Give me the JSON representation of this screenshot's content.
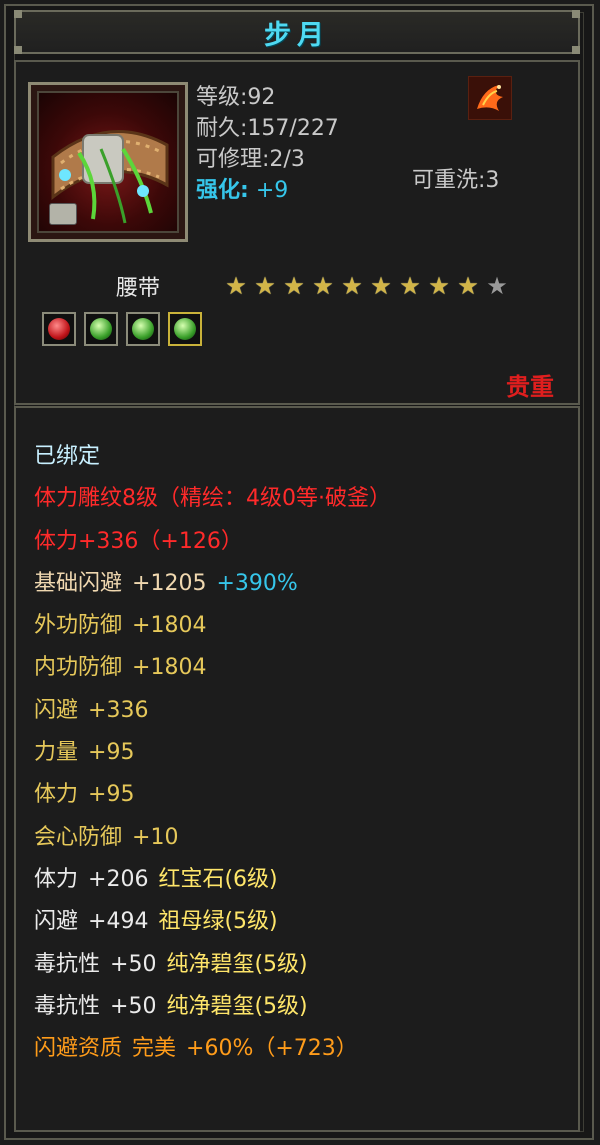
{
  "title": "步月",
  "item": {
    "level": "等级:92",
    "durability": "耐久:157/227",
    "repair": "可修理:2/3",
    "rewash": "可重洗:3",
    "enhance_label": "强化:",
    "enhance_value": "+9",
    "type": "腰带",
    "stars_filled": 9,
    "stars_total": 10,
    "rarity": "贵重",
    "sockets": [
      "red-gem",
      "green-gem",
      "green-gem",
      "green-gem"
    ]
  },
  "properties": [
    {
      "parts": [
        {
          "text": "已绑定",
          "color": "#c8f0ff"
        }
      ]
    },
    {
      "parts": [
        {
          "text": "体力雕纹8级（精绘：4级0等·破釜）",
          "color": "#ff2a2a"
        }
      ]
    },
    {
      "parts": [
        {
          "text": "体力+336（+126）",
          "color": "#ff2a2a"
        }
      ]
    },
    {
      "parts": [
        {
          "text": "基础闪避",
          "color": "#f0d8b0"
        },
        {
          "text": "+1205",
          "color": "#f0d8b0"
        },
        {
          "text": "+390%",
          "color": "#36c6ea"
        }
      ]
    },
    {
      "parts": [
        {
          "text": "外功防御",
          "color": "#e6c85a"
        },
        {
          "text": "+1804",
          "color": "#e6c85a"
        }
      ]
    },
    {
      "parts": [
        {
          "text": "内功防御",
          "color": "#e6c85a"
        },
        {
          "text": "+1804",
          "color": "#e6c85a"
        }
      ]
    },
    {
      "parts": [
        {
          "text": "闪避",
          "color": "#e6c85a"
        },
        {
          "text": "+336",
          "color": "#e6c85a"
        }
      ]
    },
    {
      "parts": [
        {
          "text": "力量",
          "color": "#e6c85a"
        },
        {
          "text": "+95",
          "color": "#e6c85a"
        }
      ]
    },
    {
      "parts": [
        {
          "text": "体力",
          "color": "#e6c85a"
        },
        {
          "text": "+95",
          "color": "#e6c85a"
        }
      ]
    },
    {
      "parts": [
        {
          "text": "会心防御",
          "color": "#e6c85a"
        },
        {
          "text": "+10",
          "color": "#e6c85a"
        }
      ]
    },
    {
      "parts": [
        {
          "text": "体力",
          "color": "#ebebeb"
        },
        {
          "text": "+206",
          "color": "#ebebeb"
        },
        {
          "text": "红宝石(6级)",
          "color": "#ffe66a"
        }
      ]
    },
    {
      "parts": [
        {
          "text": "闪避",
          "color": "#ebebeb"
        },
        {
          "text": "+494",
          "color": "#ebebeb"
        },
        {
          "text": "祖母绿(5级)",
          "color": "#ffe66a"
        }
      ]
    },
    {
      "parts": [
        {
          "text": "毒抗性",
          "color": "#ebebeb"
        },
        {
          "text": "+50",
          "color": "#ebebeb"
        },
        {
          "text": "纯净碧玺(5级)",
          "color": "#ffe66a"
        }
      ]
    },
    {
      "parts": [
        {
          "text": "毒抗性",
          "color": "#ebebeb"
        },
        {
          "text": "+50",
          "color": "#ebebeb"
        },
        {
          "text": "纯净碧玺(5级)",
          "color": "#ffe66a"
        }
      ]
    },
    {
      "parts": [
        {
          "text": "闪避资质",
          "color": "#ff9c1a"
        },
        {
          "text": "完美",
          "color": "#ff9c1a"
        },
        {
          "text": "+60%（+723）",
          "color": "#ff9c1a"
        }
      ]
    }
  ],
  "colors": {
    "title": "#4fd9f2",
    "frame": "#5a5a4e",
    "star_on": "#d2b548",
    "star_off": "#9a9a9a",
    "rarity": "#e01e1e"
  }
}
